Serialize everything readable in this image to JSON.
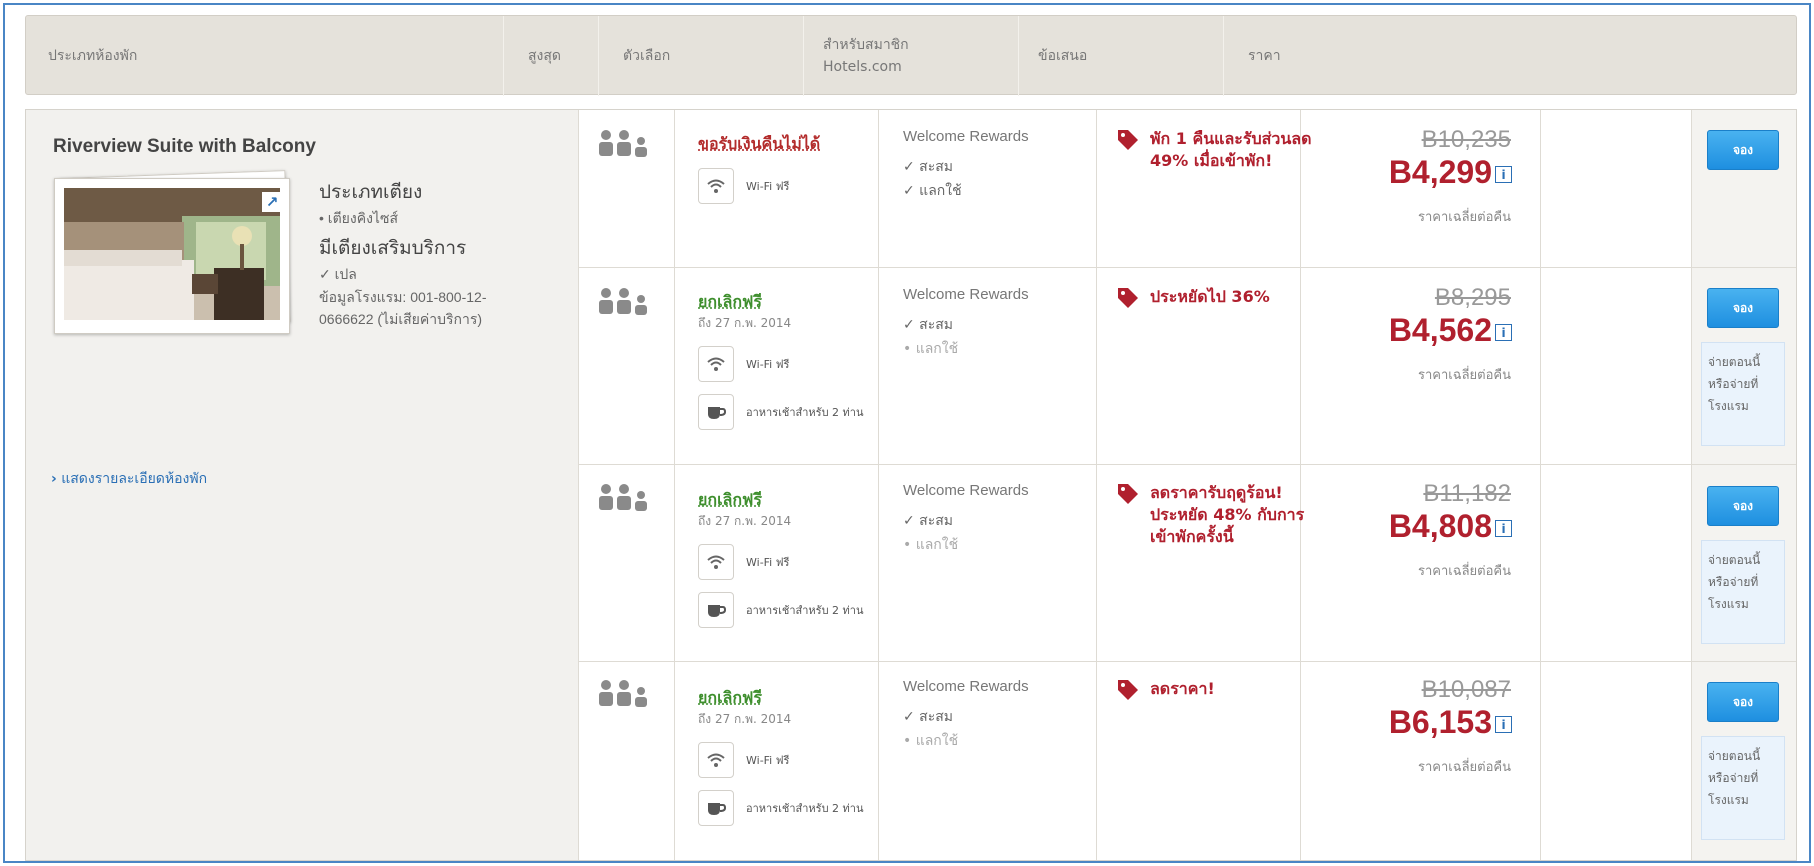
{
  "header": {
    "room_type": "ประเภทห้องพัก",
    "max": "สูงสุด",
    "options": "ตัวเลือก",
    "members_line1": "สำหรับสมาชิก",
    "members_line2": "Hotels.com",
    "offers": "ข้อเสนอ",
    "price": "ราคา"
  },
  "room": {
    "title": "Riverview Suite with Balcony",
    "bed_type_heading": "ประเภทเตียง",
    "bed_type_value": "• เตียงคิงไซส์",
    "extra_bed_heading": "มีเตียงเสริมบริการ",
    "extra_bed_value": "✓ เปล",
    "phone_line1": "ข้อมูลโรงแรม: 001-800-12-",
    "phone_line2": "0666622 (ไม่เสียค่าบริการ)",
    "show_details": "แสดงรายละเอียดห้องพัก"
  },
  "rates": [
    {
      "option_title": "ขอรับเงินคืนไม่ได้",
      "option_sub": "",
      "amenities": [
        "Wi-Fi ฟรี"
      ],
      "rewards_title": "Welcome Rewards",
      "rewards_items": [
        "✓ สะสม",
        "✓ แลกใช้"
      ],
      "deal": "พัก 1 คืนและรับส่วนลด 49% เมื่อเข้าพัก!",
      "old_price": "B10,235",
      "new_price": "B4,299",
      "price_note": "ราคาเฉลี่ยต่อคืน",
      "book_label": "จอง",
      "pay_note": ""
    },
    {
      "option_title": "ยกเลิกฟรี",
      "option_sub": "ถึง 27 ก.พ. 2014",
      "amenities": [
        "Wi-Fi ฟรี",
        "อาหารเช้าสำหรับ 2 ท่าน"
      ],
      "rewards_title": "Welcome Rewards",
      "rewards_items": [
        "✓ สะสม",
        "• แลกใช้"
      ],
      "deal": "ประหยัดไป 36%",
      "old_price": "B8,295",
      "new_price": "B4,562",
      "price_note": "ราคาเฉลี่ยต่อคืน",
      "book_label": "จอง",
      "pay_note": "จ่ายตอนนี้ หรือจ่ายที่ โรงแรม"
    },
    {
      "option_title": "ยกเลิกฟรี",
      "option_sub": "ถึง 27 ก.พ. 2014",
      "amenities": [
        "Wi-Fi ฟรี",
        "อาหารเช้าสำหรับ 2 ท่าน"
      ],
      "rewards_title": "Welcome Rewards",
      "rewards_items": [
        "✓ สะสม",
        "• แลกใช้"
      ],
      "deal": "ลดราคารับฤดูร้อน! ประหยัด 48% กับการเข้าพักครั้งนี้",
      "old_price": "B11,182",
      "new_price": "B4,808",
      "price_note": "ราคาเฉลี่ยต่อคืน",
      "book_label": "จอง",
      "pay_note": "จ่ายตอนนี้ หรือจ่ายที่ โรงแรม"
    },
    {
      "option_title": "ยกเลิกฟรี",
      "option_sub": "ถึง 27 ก.พ. 2014",
      "amenities": [
        "Wi-Fi ฟรี",
        "อาหารเช้าสำหรับ 2 ท่าน"
      ],
      "rewards_title": "Welcome Rewards",
      "rewards_items": [
        "✓ สะสม",
        "• แลกใช้"
      ],
      "deal": "ลดราคา!",
      "old_price": "B10,087",
      "new_price": "B6,153",
      "price_note": "ราคาเฉลี่ยต่อคืน",
      "book_label": "จอง",
      "pay_note": "จ่ายตอนนี้ หรือจ่ายที่ โรงแรม"
    }
  ],
  "icons": {
    "guests": "guests-icon",
    "wifi": "wifi-icon",
    "breakfast": "coffee-cup-icon",
    "deal": "price-tag-icon",
    "info": "info-icon",
    "expand": "expand-arrow-icon",
    "chevron": "chevron-right-icon"
  },
  "colors": {
    "header_bg": "#e5e2db",
    "deal_red": "#b0202e",
    "free_cancel_green": "#3f8f2e",
    "button_blue": "#1e8fe0",
    "link_blue": "#2a6fb5"
  }
}
